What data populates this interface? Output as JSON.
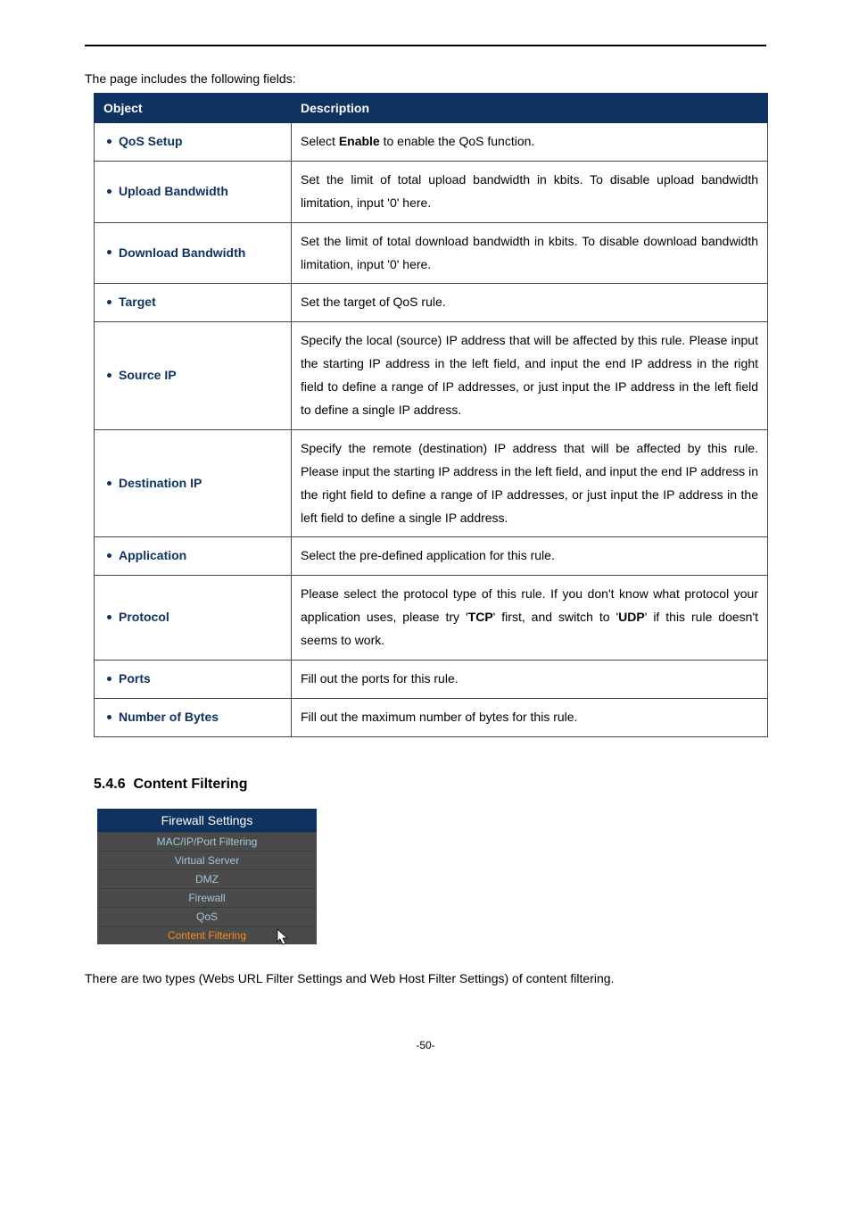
{
  "intro": "The page includes the following fields:",
  "table": {
    "headers": {
      "object": "Object",
      "description": "Description"
    },
    "rows": [
      {
        "object": "QoS Setup",
        "description_html": "Select <b>Enable</b> to enable the QoS function."
      },
      {
        "object": "Upload Bandwidth",
        "description_html": "Set the limit of total upload bandwidth in kbits. To disable upload bandwidth limitation, input '0' here.",
        "justify": true
      },
      {
        "object": "Download Bandwidth",
        "description_html": "Set the limit of total download bandwidth in kbits. To disable download bandwidth limitation, input '0' here.",
        "justify": true
      },
      {
        "object": "Target",
        "description_html": "Set the target of QoS rule."
      },
      {
        "object": "Source IP",
        "description_html": "Specify the local (source) IP address that will be affected by this rule. Please input the starting IP address in the left field, and input the end IP address in the right field to define a range of IP addresses, or just input the IP address in the left field to define a single IP address.",
        "justify": true
      },
      {
        "object": "Destination IP",
        "description_html": "Specify the remote (destination) IP address that will be affected by this rule. Please input the starting IP address in the left field, and input the end IP address in the right field to define a range of IP addresses, or just input the IP address in the left field to define a single IP address.",
        "justify": true
      },
      {
        "object": "Application",
        "description_html": "Select the pre-defined application for this rule."
      },
      {
        "object": "Protocol",
        "description_html": "Please select the protocol type of this rule. If you don't know what protocol your application uses, please try '<b>TCP</b>' first, and switch to '<b>UDP</b>' if this rule doesn't seems to work.",
        "justify": true
      },
      {
        "object": "Ports",
        "description_html": "Fill out the ports for this rule."
      },
      {
        "object": "Number of Bytes",
        "description_html": "Fill out the maximum number of bytes for this rule."
      }
    ]
  },
  "section": {
    "number": "5.4.6",
    "title": "Content Filtering"
  },
  "nav": {
    "header": "Firewall Settings",
    "items": [
      {
        "label": "MAC/IP/Port Filtering",
        "active": false
      },
      {
        "label": "Virtual Server",
        "active": false
      },
      {
        "label": "DMZ",
        "active": false
      },
      {
        "label": "Firewall",
        "active": false
      },
      {
        "label": "QoS",
        "active": false
      },
      {
        "label": "Content Filtering",
        "active": true
      }
    ]
  },
  "body_text": "There are two types (Webs URL Filter Settings and Web Host Filter Settings) of content filtering.",
  "page_number": "-50-"
}
